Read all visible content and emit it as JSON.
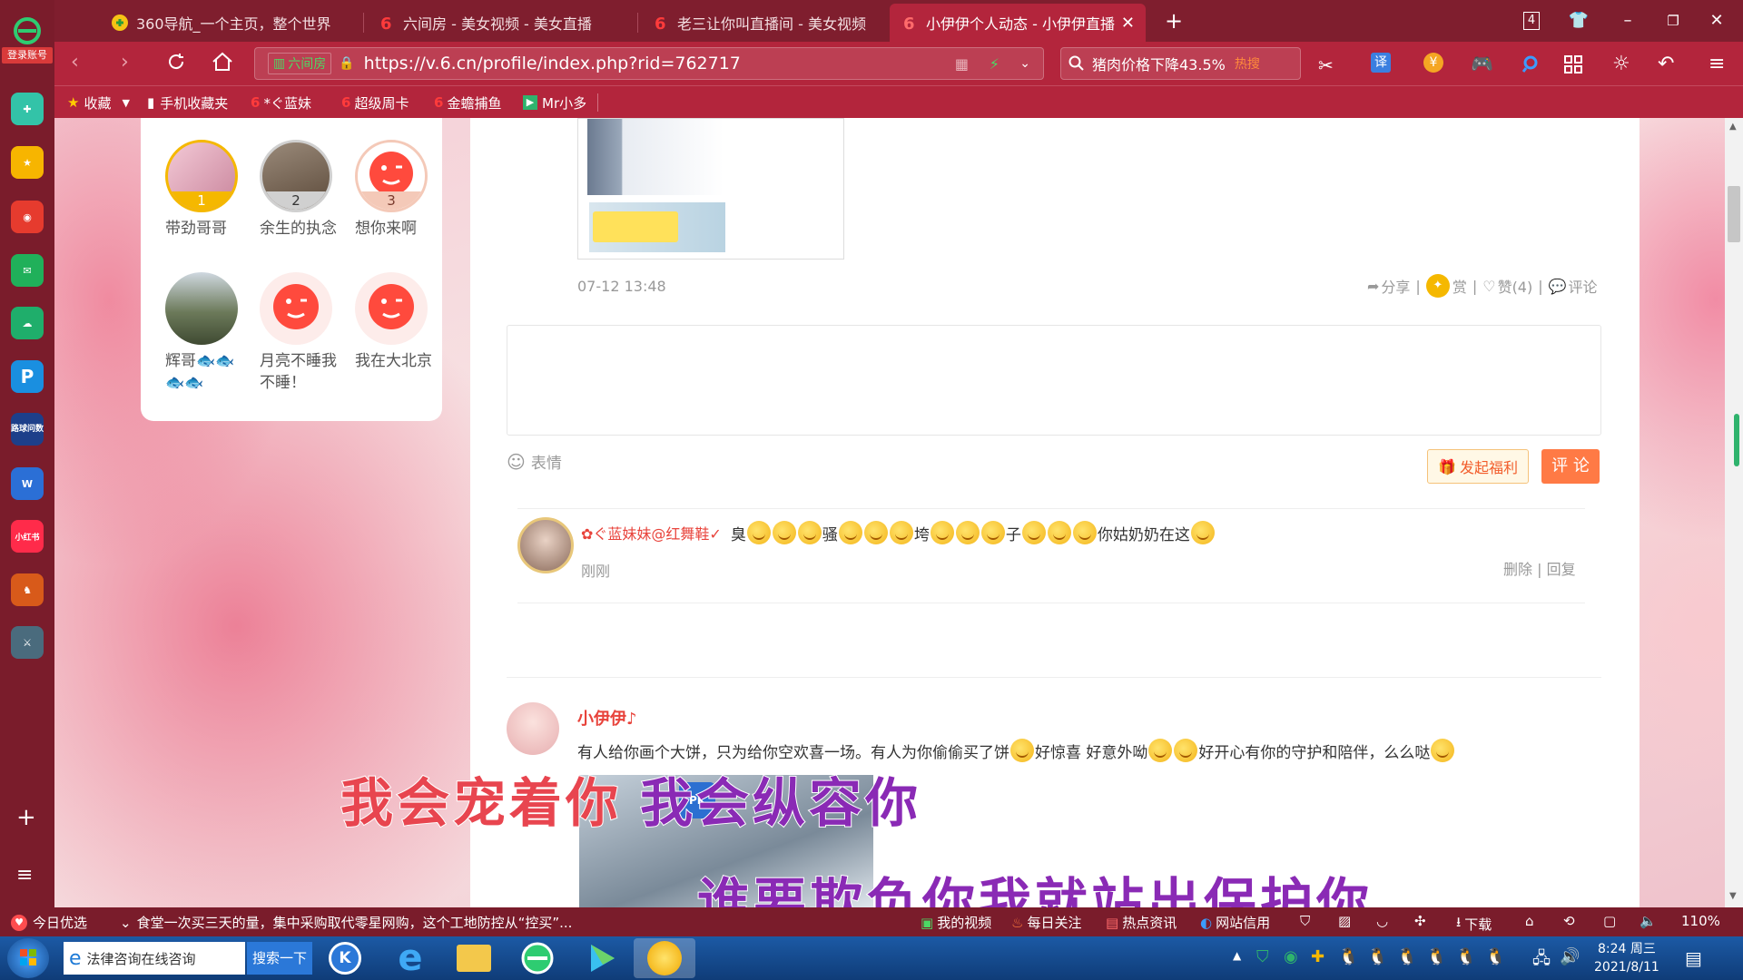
{
  "browser": {
    "login_badge": "登录账号",
    "tabs": [
      {
        "label": "360导航_一个主页，整个世界"
      },
      {
        "label": "六间房 - 美女视频 - 美女直播"
      },
      {
        "label": "老三让你叫直播间 - 美女视频"
      },
      {
        "label": "小伊伊个人动态 - 小伊伊直播"
      }
    ],
    "tab_count": "4",
    "url_site": "六间房",
    "url": "https://v.6.cn/profile/index.php?rid=762717",
    "search_text": "猪肉价格下降43.5%",
    "search_hot": "热搜",
    "translate_label": "译",
    "bookmarks": [
      {
        "label": "收藏"
      },
      {
        "label": "手机收藏夹"
      },
      {
        "label": "*ぐ蓝妹"
      },
      {
        "label": "超级周卡"
      },
      {
        "label": "金蟾捕鱼"
      },
      {
        "label": "Mr小多"
      }
    ]
  },
  "sidebar": {
    "game_label": "路球问数",
    "red_label": "小红书",
    "add_label": "+",
    "menu_label": "≡"
  },
  "fans": [
    {
      "rank": "1",
      "name": "带劲哥哥"
    },
    {
      "rank": "2",
      "name": "余生的执念"
    },
    {
      "rank": "3",
      "name": "想你来啊"
    },
    {
      "rank": "",
      "name": "辉哥🐟🐟🐟🐟"
    },
    {
      "rank": "",
      "name": "月亮不睡我不睡！"
    },
    {
      "rank": "",
      "name": "我在大北京"
    }
  ],
  "post1": {
    "time": "07-12 13:48",
    "share": "分享",
    "reward": "赏",
    "like": "赞(4)",
    "comment": "评论"
  },
  "comment_box": {
    "emoji_label": "表情",
    "welfare_button": "发起福利",
    "submit_button": "评 论"
  },
  "comment1": {
    "author": "✿ぐ蓝妹妹@红舞鞋✓",
    "text_a": "臭",
    "text_b": "骚",
    "text_c": "垮",
    "text_d": "子",
    "text_e": "你姑奶奶在这",
    "time": "刚刚",
    "delete": "删除",
    "reply": "回复"
  },
  "post2": {
    "author": "小伊伊♪",
    "text_a": "有人给你画个大饼，只为给你空欢喜一场。有人为你偷偷买了饼",
    "text_b": "好惊喜 好意外呦",
    "text_c": "好开心有你的守护和陪伴，么么哒"
  },
  "lyrics": {
    "line1a": "我会宠着你",
    "line1b": "我会纵容你",
    "line2": "谁要欺负你我就站出保护你"
  },
  "statusbar": {
    "today": "今日优选",
    "news": "食堂一次买三天的量，集中采购取代零星网购，这个工地防控从“控买”...",
    "my_video": "我的视频",
    "daily": "每日关注",
    "hot": "热点资讯",
    "credit": "网站信用",
    "download": "下载",
    "zoom": "110%"
  },
  "taskbar": {
    "ie_label": "法律咨询在线咨询",
    "search_btn": "搜索一下",
    "time": "8:24 周三",
    "date": "2021/8/11"
  },
  "colors": {
    "browser_red": "#b3253c",
    "accent_orange": "#ff7a45",
    "author_red": "#e8433b"
  }
}
